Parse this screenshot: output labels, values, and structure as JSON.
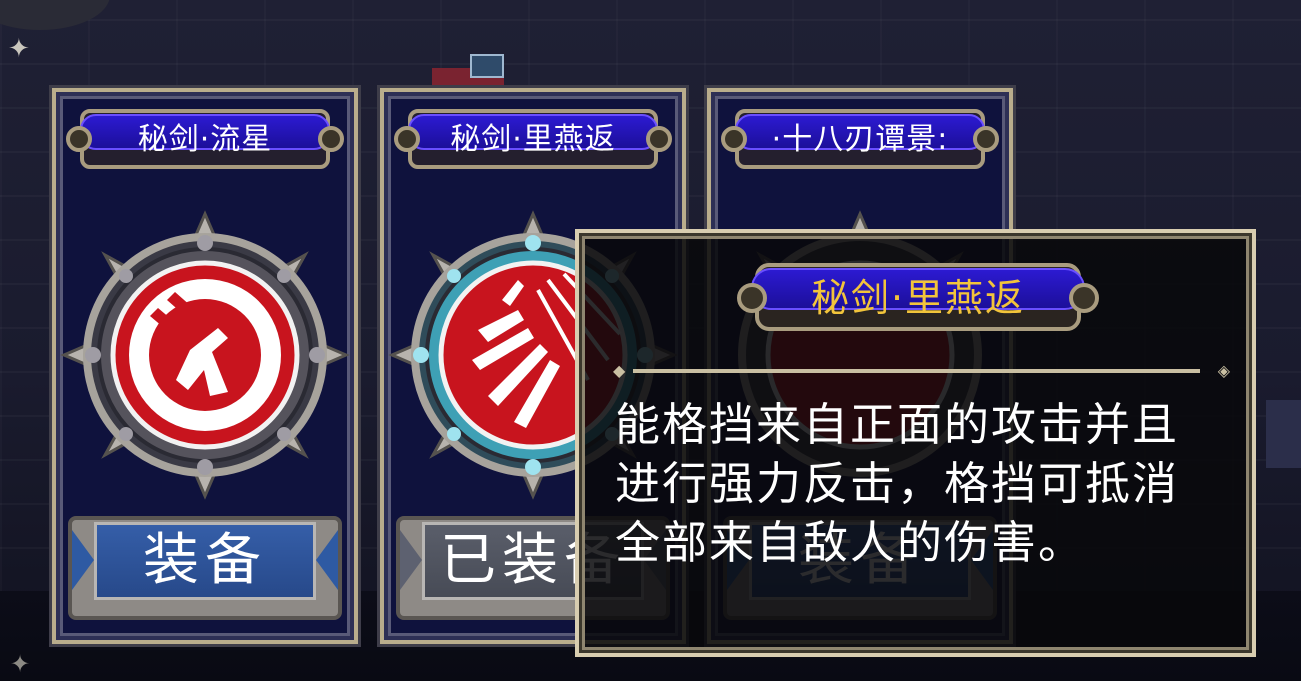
{
  "cards": [
    {
      "title": "秘剑·流星",
      "button_label": "装备",
      "icon": "meteor-emblem-icon",
      "state": "available"
    },
    {
      "title": "秘剑·里燕返",
      "button_label": "已装备",
      "icon": "swallow-slash-emblem-icon",
      "state": "equipped"
    },
    {
      "title": "·十八刃谭景:",
      "button_label": "装备",
      "icon": "eighteen-blades-emblem-icon",
      "state": "available"
    }
  ],
  "tooltip": {
    "title": "秘剑·里燕返",
    "description": "能格挡来自正面的攻击并且进行强力反击，格挡可抵消全部来自敌人的伤害。"
  },
  "colors": {
    "card_bg": "#0f123d",
    "title_bar": "#2c1ad1",
    "button_blue": "#355ea8",
    "button_gray": "#5a5e6a",
    "tooltip_title": "#f2c43b",
    "emblem_red": "#c8141e"
  }
}
